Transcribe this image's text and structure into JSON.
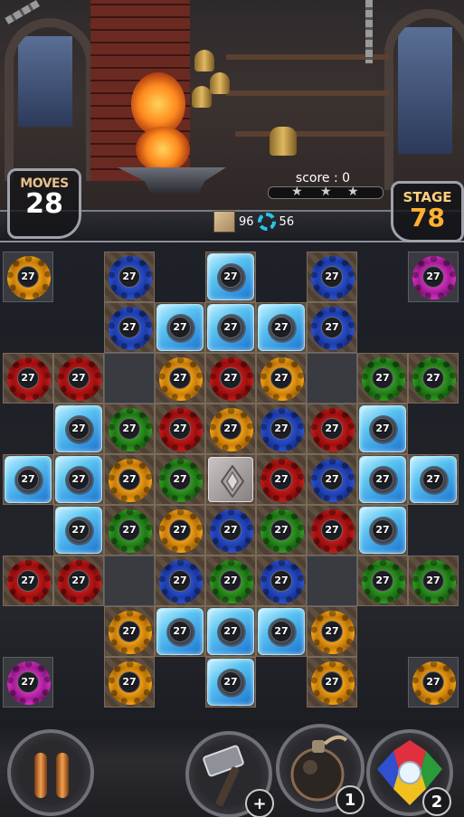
{
  "hud": {
    "moves_label": "MOVES",
    "moves_value": "28",
    "stage_label": "STAGE",
    "stage_value": "78",
    "score_text": "score : 0",
    "score_progress": 0,
    "stars_total": 3,
    "item_paper_count": "96",
    "item_cog_count": "56"
  },
  "board": {
    "gear_value": "27",
    "cells": [
      {
        "c": 0,
        "r": 0,
        "bg": "base",
        "t": "gear",
        "col": "orange"
      },
      {
        "c": 2,
        "r": 0,
        "bg": "stone",
        "t": "gear",
        "col": "blue"
      },
      {
        "c": 4,
        "r": 0,
        "bg": "stone",
        "t": "ice"
      },
      {
        "c": 6,
        "r": 0,
        "bg": "stone",
        "t": "gear",
        "col": "blue"
      },
      {
        "c": 8,
        "r": 0,
        "bg": "base",
        "t": "gear",
        "col": "magenta"
      },
      {
        "c": 2,
        "r": 1,
        "bg": "stone",
        "t": "gear",
        "col": "blue"
      },
      {
        "c": 3,
        "r": 1,
        "bg": "stone",
        "t": "ice"
      },
      {
        "c": 4,
        "r": 1,
        "bg": "stone",
        "t": "ice"
      },
      {
        "c": 5,
        "r": 1,
        "bg": "stone",
        "t": "ice"
      },
      {
        "c": 6,
        "r": 1,
        "bg": "stone",
        "t": "gear",
        "col": "blue"
      },
      {
        "c": 0,
        "r": 2,
        "bg": "stone",
        "t": "gear",
        "col": "red"
      },
      {
        "c": 1,
        "r": 2,
        "bg": "stone",
        "t": "gear",
        "col": "red"
      },
      {
        "c": 2,
        "r": 2,
        "bg": "base",
        "t": "empty"
      },
      {
        "c": 3,
        "r": 2,
        "bg": "stone",
        "t": "gear",
        "col": "orange"
      },
      {
        "c": 4,
        "r": 2,
        "bg": "stone",
        "t": "gear",
        "col": "red"
      },
      {
        "c": 5,
        "r": 2,
        "bg": "stone",
        "t": "gear",
        "col": "orange"
      },
      {
        "c": 6,
        "r": 2,
        "bg": "base",
        "t": "empty"
      },
      {
        "c": 7,
        "r": 2,
        "bg": "stone",
        "t": "gear",
        "col": "green"
      },
      {
        "c": 8,
        "r": 2,
        "bg": "stone",
        "t": "gear",
        "col": "green"
      },
      {
        "c": 1,
        "r": 3,
        "bg": "stone",
        "t": "ice"
      },
      {
        "c": 2,
        "r": 3,
        "bg": "stone",
        "t": "gear",
        "col": "green"
      },
      {
        "c": 3,
        "r": 3,
        "bg": "stone",
        "t": "gear",
        "col": "red"
      },
      {
        "c": 4,
        "r": 3,
        "bg": "stone",
        "t": "gear",
        "col": "orange"
      },
      {
        "c": 5,
        "r": 3,
        "bg": "stone",
        "t": "gear",
        "col": "blue"
      },
      {
        "c": 6,
        "r": 3,
        "bg": "stone",
        "t": "gear",
        "col": "red"
      },
      {
        "c": 7,
        "r": 3,
        "bg": "stone",
        "t": "ice"
      },
      {
        "c": 0,
        "r": 4,
        "bg": "stone",
        "t": "ice"
      },
      {
        "c": 1,
        "r": 4,
        "bg": "stone",
        "t": "ice"
      },
      {
        "c": 2,
        "r": 4,
        "bg": "stone",
        "t": "gear",
        "col": "orange"
      },
      {
        "c": 3,
        "r": 4,
        "bg": "stone",
        "t": "gear",
        "col": "green"
      },
      {
        "c": 4,
        "r": 4,
        "bg": "stone",
        "t": "metal"
      },
      {
        "c": 5,
        "r": 4,
        "bg": "stone",
        "t": "gear",
        "col": "red"
      },
      {
        "c": 6,
        "r": 4,
        "bg": "stone",
        "t": "gear",
        "col": "blue"
      },
      {
        "c": 7,
        "r": 4,
        "bg": "stone",
        "t": "ice"
      },
      {
        "c": 8,
        "r": 4,
        "bg": "stone",
        "t": "ice"
      },
      {
        "c": 1,
        "r": 5,
        "bg": "stone",
        "t": "ice"
      },
      {
        "c": 2,
        "r": 5,
        "bg": "stone",
        "t": "gear",
        "col": "green"
      },
      {
        "c": 3,
        "r": 5,
        "bg": "stone",
        "t": "gear",
        "col": "orange"
      },
      {
        "c": 4,
        "r": 5,
        "bg": "stone",
        "t": "gear",
        "col": "blue"
      },
      {
        "c": 5,
        "r": 5,
        "bg": "stone",
        "t": "gear",
        "col": "green"
      },
      {
        "c": 6,
        "r": 5,
        "bg": "stone",
        "t": "gear",
        "col": "red"
      },
      {
        "c": 7,
        "r": 5,
        "bg": "stone",
        "t": "ice"
      },
      {
        "c": 0,
        "r": 6,
        "bg": "stone",
        "t": "gear",
        "col": "red"
      },
      {
        "c": 1,
        "r": 6,
        "bg": "stone",
        "t": "gear",
        "col": "red"
      },
      {
        "c": 2,
        "r": 6,
        "bg": "base",
        "t": "empty"
      },
      {
        "c": 3,
        "r": 6,
        "bg": "stone",
        "t": "gear",
        "col": "blue"
      },
      {
        "c": 4,
        "r": 6,
        "bg": "stone",
        "t": "gear",
        "col": "green"
      },
      {
        "c": 5,
        "r": 6,
        "bg": "stone",
        "t": "gear",
        "col": "blue"
      },
      {
        "c": 6,
        "r": 6,
        "bg": "base",
        "t": "empty"
      },
      {
        "c": 7,
        "r": 6,
        "bg": "stone",
        "t": "gear",
        "col": "green"
      },
      {
        "c": 8,
        "r": 6,
        "bg": "stone",
        "t": "gear",
        "col": "green"
      },
      {
        "c": 2,
        "r": 7,
        "bg": "stone",
        "t": "gear",
        "col": "orange"
      },
      {
        "c": 3,
        "r": 7,
        "bg": "stone",
        "t": "ice"
      },
      {
        "c": 4,
        "r": 7,
        "bg": "stone",
        "t": "ice"
      },
      {
        "c": 5,
        "r": 7,
        "bg": "stone",
        "t": "ice"
      },
      {
        "c": 6,
        "r": 7,
        "bg": "stone",
        "t": "gear",
        "col": "orange"
      },
      {
        "c": 0,
        "r": 8,
        "bg": "base",
        "t": "gear",
        "col": "magenta"
      },
      {
        "c": 2,
        "r": 8,
        "bg": "stone",
        "t": "gear",
        "col": "orange"
      },
      {
        "c": 4,
        "r": 8,
        "bg": "stone",
        "t": "ice"
      },
      {
        "c": 6,
        "r": 8,
        "bg": "stone",
        "t": "gear",
        "col": "orange"
      },
      {
        "c": 8,
        "r": 8,
        "bg": "base",
        "t": "gear",
        "col": "orange"
      }
    ]
  },
  "boosters": {
    "hammer_badge": "+",
    "bomb_count": "1",
    "gem_count": "2"
  },
  "icons": {
    "pause": "pause-icon",
    "hammer": "hammer-icon",
    "bomb": "bomb-icon",
    "gem": "gem-icon"
  }
}
